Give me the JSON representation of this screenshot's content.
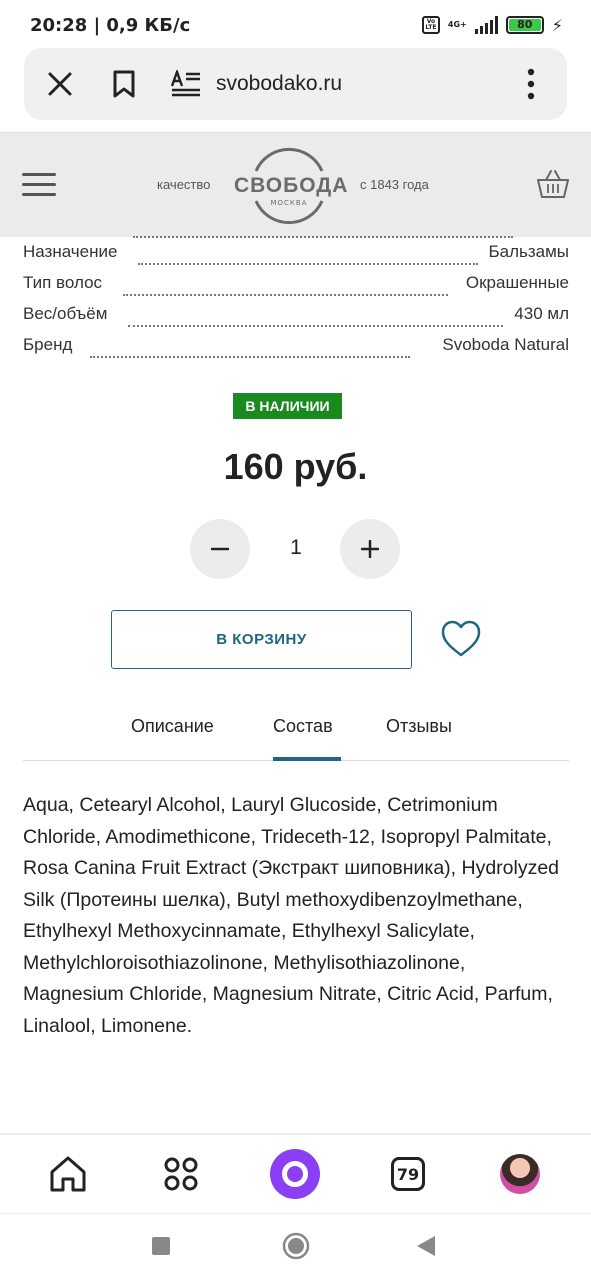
{
  "status_bar": {
    "time_speed": "20:28 | 0,9 КБ/с",
    "network": "4G+",
    "volte": "Vo LTE",
    "battery": "80"
  },
  "browser": {
    "url": "svobodako.ru",
    "close_icon": "close-icon",
    "bookmark_icon": "bookmark-icon",
    "reader_icon": "reader-mode-icon",
    "menu_icon": "more-vert-icon"
  },
  "site_header": {
    "tag_left": "качество",
    "logo_text": "СВОБОДА",
    "logo_sub": "МОСКВА",
    "tag_right": "с 1843 года"
  },
  "specs": [
    {
      "label": "Назначение",
      "value": "Бальзамы"
    },
    {
      "label": "Тип волос",
      "value": "Окрашенные"
    },
    {
      "label": "Вес/объём",
      "value": "430 мл"
    },
    {
      "label": "Бренд",
      "value": "Svoboda Natural"
    }
  ],
  "product": {
    "availability": "В НАЛИЧИИ",
    "price": "160 руб.",
    "quantity": "1",
    "minus": "−",
    "plus": "+",
    "add_to_cart": "В КОРЗИНУ"
  },
  "tabs": [
    {
      "label": "Описание"
    },
    {
      "label": "Состав"
    },
    {
      "label": "Отзывы"
    }
  ],
  "active_tab": "Состав",
  "composition": "Aqua, Cetearyl Alcohol, Lauryl Glucoside, Cetrimonium Chloride, Amodimethicone, Trideceth-12, Isopropyl Palmitate, Rosa Canina Fruit Extract (Экстракт шиповника), Hydrolyzed Silk (Протеины шелка), Butyl methoxydibenzoylmethane, Ethylhexyl Methoxycinnamate, Ethylhexyl Salicylate, Methylchloroisothiazolinone, Methylisothiazolinone, Magnesium Chloride, Magnesium Nitrate, Citric Acid, Parfum, Linalool, Limonene.",
  "bottom_nav": {
    "tabs_count": "79"
  },
  "colors": {
    "accent": "#1f6684",
    "badge": "#1a8a1f",
    "alice": "#8a3ff5"
  }
}
